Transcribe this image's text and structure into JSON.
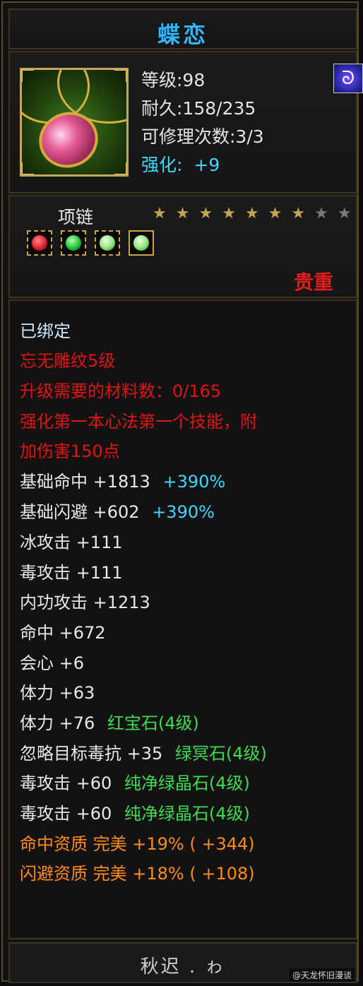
{
  "item": {
    "name": "蝶恋",
    "level_text": "等级:98",
    "durability_text": "耐久:158/235",
    "repair_text": "可修理次数:3/3",
    "enhance_label": "强化:",
    "enhance_value": "+9",
    "badge_icon": "swirl-icon",
    "type": "项链",
    "stars_filled": 7,
    "stars_total": 9,
    "stars": [
      "★",
      "★",
      "★",
      "★",
      "★",
      "★",
      "★",
      "★",
      "★"
    ],
    "quality": "贵重"
  },
  "sockets": [
    {
      "gem": "red-gem-icon",
      "color": "#e0202a"
    },
    {
      "gem": "green-gem-icon",
      "color": "#1fc43a"
    },
    {
      "gem": "light-green-gem-icon",
      "color": "#8ee37a"
    },
    {
      "gem": "light-green-gem-icon",
      "color": "#8ee37a"
    }
  ],
  "attributes": {
    "bound": "已绑定",
    "engrave": "忘无雕纹5级",
    "material": "升级需要的材料数：0/165",
    "skill_line1": "强化第一本心法第一个技能，附",
    "skill_line2": "加伤害150点",
    "rows": [
      {
        "label": "基础命中  +1813",
        "extra": "+390%"
      },
      {
        "label": "基础闪避  +602",
        "extra": "+390%"
      }
    ],
    "stats": [
      "冰攻击  +111",
      "毒攻击  +111",
      "内功攻击  +1213",
      "命中  +672",
      "会心  +6",
      "体力  +63"
    ],
    "gem_stats": [
      {
        "stat": "体力  +76",
        "gem": "红宝石(4级)"
      },
      {
        "stat": "忽略目标毒抗  +35",
        "gem": "绿冥石(4级)"
      },
      {
        "stat": "毒攻击  +60",
        "gem": "纯净绿晶石(4级)"
      },
      {
        "stat": "毒攻击  +60",
        "gem": "纯净绿晶石(4级)"
      }
    ],
    "aptitudes": [
      "命中资质   完美 +19% ( +344)",
      "闪避资质   完美 +18% ( +108)"
    ]
  },
  "footer": {
    "owner": "秋迟 . ゎ",
    "watermark": "@天龙怀旧漫谈"
  },
  "colors": {
    "title": "#31b7ff",
    "red": "#e01414",
    "cyan": "#3fd6ff",
    "orange": "#ff8c1a",
    "gold": "#c6a65a"
  }
}
